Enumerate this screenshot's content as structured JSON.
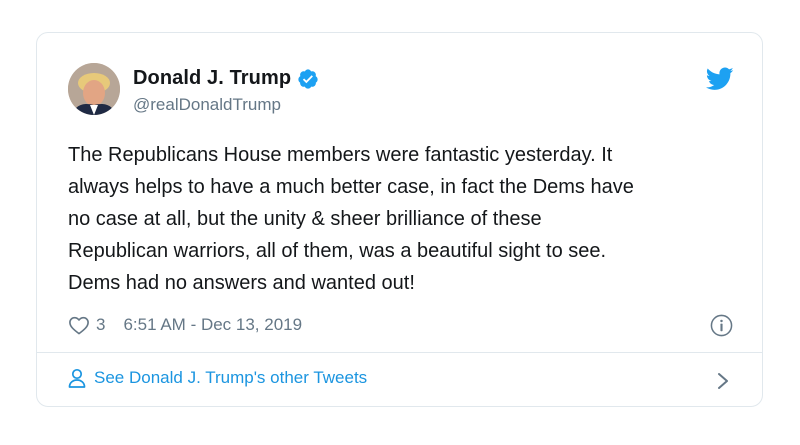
{
  "tweet": {
    "author_name": "Donald J. Trump",
    "author_handle": "@realDonaldTrump",
    "verified": true,
    "text_lines": [
      "The Republicans House members were fantastic yesterday. It",
      "always helps to have a much better case, in fact the Dems have",
      "no case at all, but the unity & sheer brilliance of these",
      "Republican warriors, all of them, was a beautiful sight to see.",
      "Dems had no answers and wanted out!"
    ],
    "like_count": "3",
    "timestamp": "6:51 AM - Dec 13, 2019"
  },
  "footer": {
    "link_label": "See Donald J. Trump's other Tweets"
  },
  "icons": {
    "brand": "twitter-bird-icon",
    "verified": "verified-badge-icon",
    "like": "heart-icon",
    "info": "info-icon",
    "profile": "person-icon",
    "more": "chevron-right-icon"
  },
  "colors": {
    "brand_blue": "#1da1f2",
    "link_blue": "#1b95e0",
    "text_primary": "#14171a",
    "text_secondary": "#657786",
    "border": "#e1e8ed"
  }
}
